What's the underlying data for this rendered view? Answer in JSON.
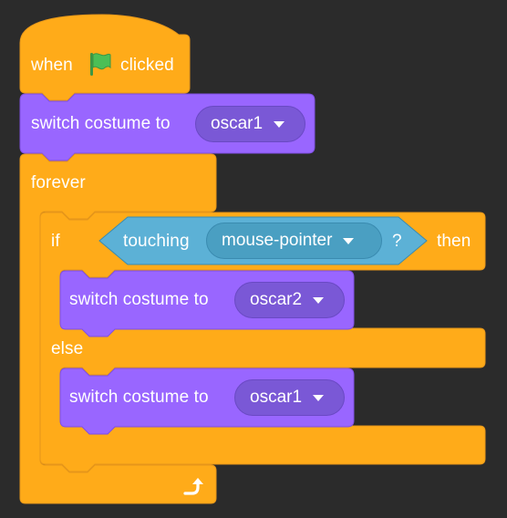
{
  "colors": {
    "background": "#2b2b2b",
    "events": "#ffab19",
    "control": "#ffab19",
    "looks": "#9966ff",
    "sensing": "#5cb1d6",
    "flag": "#4cbf56"
  },
  "script": {
    "hat": {
      "prefix": "when",
      "icon": "green-flag-icon",
      "suffix": "clicked"
    },
    "first_switch": {
      "label": "switch costume to",
      "value": "oscar1"
    },
    "forever": {
      "label": "forever",
      "icon": "loop-arrow-icon"
    },
    "if_else": {
      "if_label": "if",
      "condition": {
        "label": "touching",
        "value": "mouse-pointer",
        "suffix": "?"
      },
      "then_label": "then",
      "else_label": "else"
    },
    "then_switch": {
      "label": "switch costume to",
      "value": "oscar2"
    },
    "else_switch": {
      "label": "switch costume to",
      "value": "oscar1"
    }
  }
}
